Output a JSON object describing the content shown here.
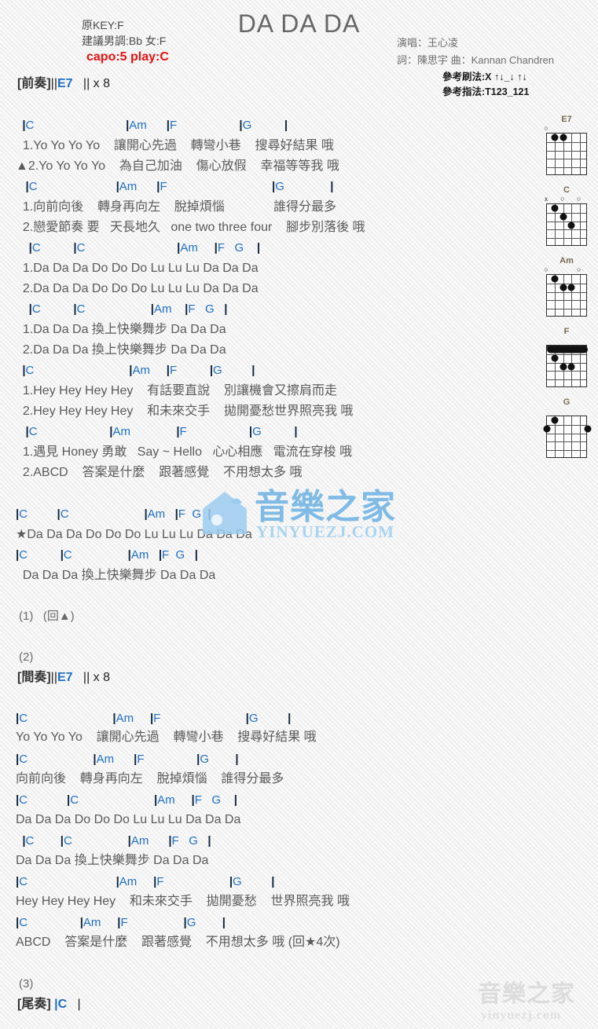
{
  "header": {
    "title": "DA DA DA",
    "original_key": "原KEY:F",
    "suggested_key": "建議男調:Bb 女:F",
    "capo": "capo:5 play:C",
    "singer": "演唱：王心凌",
    "writers": "詞：陳思宇  曲：Kannan Chandren",
    "strum_ref": "參考刷法:X ↑↓_↓ ↑↓",
    "fingerstyle_ref": "參考指法:T123_121",
    "capo_color": "#e81010",
    "chord_color": "#1f6fc4"
  },
  "sections": {
    "intro_label": "[前奏]",
    "intro_bars_open": "||",
    "intro_chord": "E7",
    "intro_bars_close": "||",
    "intro_repeat": "x 8",
    "interlude_label": "[間奏]",
    "interlude_bars_open": "||",
    "interlude_chord": "E7",
    "interlude_bars_close": "||",
    "interlude_repeat": "x 8",
    "outro_label": "[尾奏]",
    "outro_chord": "|C",
    "outro_bar_end": "|",
    "marker_1": "(1)   (回▲)",
    "marker_2": "(2)",
    "marker_3": "(3)"
  },
  "verse1": {
    "chordline_1": "  |C                            |Am      |F                   |G          |",
    "lyric_1a": "  1.Yo Yo Yo Yo    讓開心先過    轉彎小巷    搜尋好結果 哦",
    "lyric_1b": "▲2.Yo Yo Yo Yo    為自己加油    傷心放假    幸福等等我 哦",
    "chordline_2": "   |C                        |Am      |F                                |G              |",
    "lyric_2a": "  1.向前向後    轉身再向左    脫掉煩惱              誰得分最多",
    "lyric_2b": "  2.戀愛節奏 要   天長地久   one two three four    腳步別落後 哦"
  },
  "chorus1": {
    "chordline_1": "    |C          |C                            |Am     |F   G    |",
    "lyric_1a": "  1.Da Da Da Do Do Do Lu Lu Lu Da Da Da",
    "lyric_1b": "  2.Da Da Da Do Do Do Lu Lu Lu Da Da Da",
    "chordline_2": "    |C          |C                    |Am    |F   G   |",
    "lyric_2a": "  1.Da Da Da 換上快樂舞步 Da Da Da",
    "lyric_2b": "  2.Da Da Da 換上快樂舞步 Da Da Da"
  },
  "verse2": {
    "chordline_1": "  |C                             |Am     |F          |G         |",
    "lyric_1a": "  1.Hey Hey Hey Hey    有話要直說    別讓機會又擦肩而走",
    "lyric_1b": "  2.Hey Hey Hey Hey    和未來交手    拋開憂愁世界照亮我 哦",
    "chordline_2": "   |C                      |Am              |F                   |G          |",
    "lyric_2a": "  1.遇見 Honey 勇敢   Say ~ Hello   心心相應   電流在穿梭 哦",
    "lyric_2b": "  2.ABCD    答案是什麼    跟著感覺    不用想太多 哦"
  },
  "star_chorus": {
    "chordline_1": "|C         |C                       |Am   |F  G  |",
    "lyric_1": "★Da Da Da Do Do Do Lu Lu Lu Da Da Da",
    "chordline_2": "|C          |C                 |Am   |F  G   |",
    "lyric_2": "  Da Da Da 換上快樂舞步 Da Da Da"
  },
  "verse3": {
    "chordline_1": "|C                          |Am     |F                          |G         |",
    "lyric_1": "Yo Yo Yo Yo    讓開心先過    轉彎小巷    搜尋好結果 哦",
    "chordline_2": "|C                    |Am      |F                |G        |",
    "lyric_2": "向前向後    轉身再向左    脫掉煩惱    誰得分最多",
    "chordline_3": "|C            |C                       |Am     |F   G    |",
    "lyric_3": "Da Da Da Do Do Do Lu Lu Lu Da Da Da",
    "chordline_4": "  |C        |C                 |Am      |F   G   |",
    "lyric_4": "Da Da Da 換上快樂舞步 Da Da Da",
    "chordline_5": "|C                           |Am     |F                    |G         |",
    "lyric_5": "Hey Hey Hey Hey    和未來交手    拋開憂愁    世界照亮我 哦",
    "chordline_6": "|C                |Am     |F                 |G        |",
    "lyric_6": "ABCD    答案是什麼    跟著感覺    不用想太多 哦 (回★4次)"
  },
  "chord_diagrams": [
    {
      "name": "E7",
      "open_markers": [
        {
          "string": 1,
          "symbol": "○"
        }
      ],
      "dots": [
        {
          "string": 2,
          "fret": 1
        },
        {
          "string": 3,
          "fret": 1
        }
      ],
      "barre": null,
      "muted": []
    },
    {
      "name": "C",
      "open_markers": [
        {
          "string": 3,
          "symbol": "○"
        },
        {
          "string": 5,
          "symbol": "○"
        }
      ],
      "dots": [
        {
          "string": 2,
          "fret": 1
        },
        {
          "string": 3,
          "fret": 2
        },
        {
          "string": 4,
          "fret": 3
        }
      ],
      "barre": null,
      "muted": [
        {
          "string": 1,
          "symbol": "x"
        }
      ]
    },
    {
      "name": "Am",
      "open_markers": [
        {
          "string": 1,
          "symbol": "○"
        },
        {
          "string": 5,
          "symbol": "○"
        }
      ],
      "dots": [
        {
          "string": 2,
          "fret": 1
        },
        {
          "string": 3,
          "fret": 2
        },
        {
          "string": 4,
          "fret": 2
        }
      ],
      "barre": null,
      "muted": []
    },
    {
      "name": "F",
      "open_markers": [],
      "dots": [
        {
          "string": 2,
          "fret": 2
        },
        {
          "string": 3,
          "fret": 3
        },
        {
          "string": 4,
          "fret": 3
        }
      ],
      "barre": {
        "fret": 1,
        "from": 1,
        "to": 6
      },
      "muted": []
    },
    {
      "name": "G",
      "open_markers": [],
      "dots": [
        {
          "string": 1,
          "fret": 2
        },
        {
          "string": 2,
          "fret": 1
        },
        {
          "string": 6,
          "fret": 2
        }
      ],
      "barre": null,
      "muted": []
    }
  ],
  "watermark": {
    "brand_cn": "音樂之家",
    "brand_url": "yinyuezj.com",
    "brand_url_upper": "YINYUEZJ.COM",
    "color_center": "#9ccdf0",
    "color_bottom": "#dedede"
  }
}
